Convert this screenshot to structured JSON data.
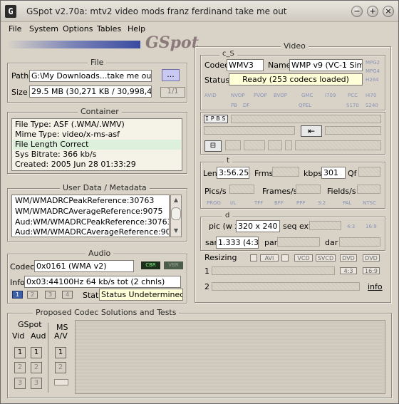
{
  "window": {
    "title": "GSpot v2.70a: mtv2 video mods franz ferdinand take me out",
    "logo": "GSpot"
  },
  "menu": {
    "file": "File",
    "system": "System",
    "options": "Options",
    "tables": "Tables",
    "help": "Help"
  },
  "file": {
    "title": "File",
    "path_label": "Path",
    "path_value": "G:\\My Downloads...take me out.asf",
    "browse_label": "...",
    "size_label": "Size",
    "size_value": "29.5 MB (30,271 KB / 30,998,413 b",
    "part_label": "1/1"
  },
  "container": {
    "title": "Container",
    "lines": [
      "File Type: ASF (.WMA/.WMV)",
      "Mime Type: video/x-ms-asf",
      "File Length Correct",
      "Sys Bitrate: 366 kb/s",
      "Created:     2005 Jun 28    01:33:29"
    ]
  },
  "metadata": {
    "title": "User Data / Metadata",
    "lines": [
      "WM/WMADRCPeakReference:30763",
      "WM/WMADRCAverageReference:9075",
      "Aud:WM/WMADRCPeakReference:30763",
      "Aud:WM/WMADRCAverageReference:9075"
    ]
  },
  "audio": {
    "title": "Audio",
    "codec_label": "Codec",
    "codec_value": "0x0161 (WMA v2)",
    "cbr": "CBR",
    "vbr": "VBR",
    "info_label": "Info",
    "info_value": "0x03:44100Hz  64 kb/s tot (2 chnls)",
    "streams": [
      "1",
      "2",
      "3",
      "4"
    ],
    "stat_label": "Stat",
    "stat_value": "Status Undetermined"
  },
  "video": {
    "title": "Video",
    "cs_title": "c_S",
    "codec_label": "Codec",
    "codec_value": "WMV3",
    "name_label": "Name",
    "name_value": "WMP v9 (VC-1 Simpl",
    "status_label": "Status",
    "status_value": "Ready (253 codecs loaded)",
    "side_tags": [
      "MPG2",
      "MPG4",
      "H264"
    ],
    "codec_tags": [
      "AVID",
      "NVOP",
      "PVOP",
      "BVOP",
      "GMC",
      "I709",
      "PCC",
      "I470",
      "PB",
      "DF",
      "QPEL",
      "S170",
      "S240"
    ],
    "frame_btns": [
      "I",
      "P",
      "B",
      "S"
    ],
    "t_title": "t",
    "len_label": "Len",
    "len_value": "3:56.250",
    "frms_label": "Frms",
    "kbps_label": "kbps",
    "kbps_value": "301",
    "qf_label": "Qf",
    "pics_label": "Pics/s",
    "frames_label": "Frames/s",
    "fields_label": "Fields/s",
    "fmt_tags": [
      "PROG",
      "I/L",
      "TFF",
      "BFF",
      "PPF",
      "3:2",
      "PAL",
      "NTSC"
    ],
    "d_title": "d",
    "pic_label": "pic (w x",
    "pic_value": "320 x 240",
    "seqext_label": "seq ext",
    "aspect_tags": [
      "4:3",
      "16:9"
    ],
    "sar_label": "sar",
    "sar_value": "1.333 (4:3)",
    "par_label": "par",
    "dar_label": "dar",
    "resizing_label": "Resizing",
    "resize_tags": [
      "AVI",
      "VCD",
      "SVCD",
      "DVD",
      "DVD",
      "4:3",
      "16:9"
    ],
    "row1": "1",
    "row2": "2",
    "info_link": "info"
  },
  "proposed": {
    "title": "Proposed Codec Solutions and Tests",
    "gspot_label": "GSpot",
    "vid_label": "Vid",
    "aud_label": "Aud",
    "ms_label": "MS",
    "av_label": "A/V",
    "nums": [
      "1",
      "2",
      "3"
    ]
  },
  "colors": {
    "accent": "#3c5fa8",
    "field_bg": "#ffffff",
    "window_bg": "#d9d3c7"
  }
}
